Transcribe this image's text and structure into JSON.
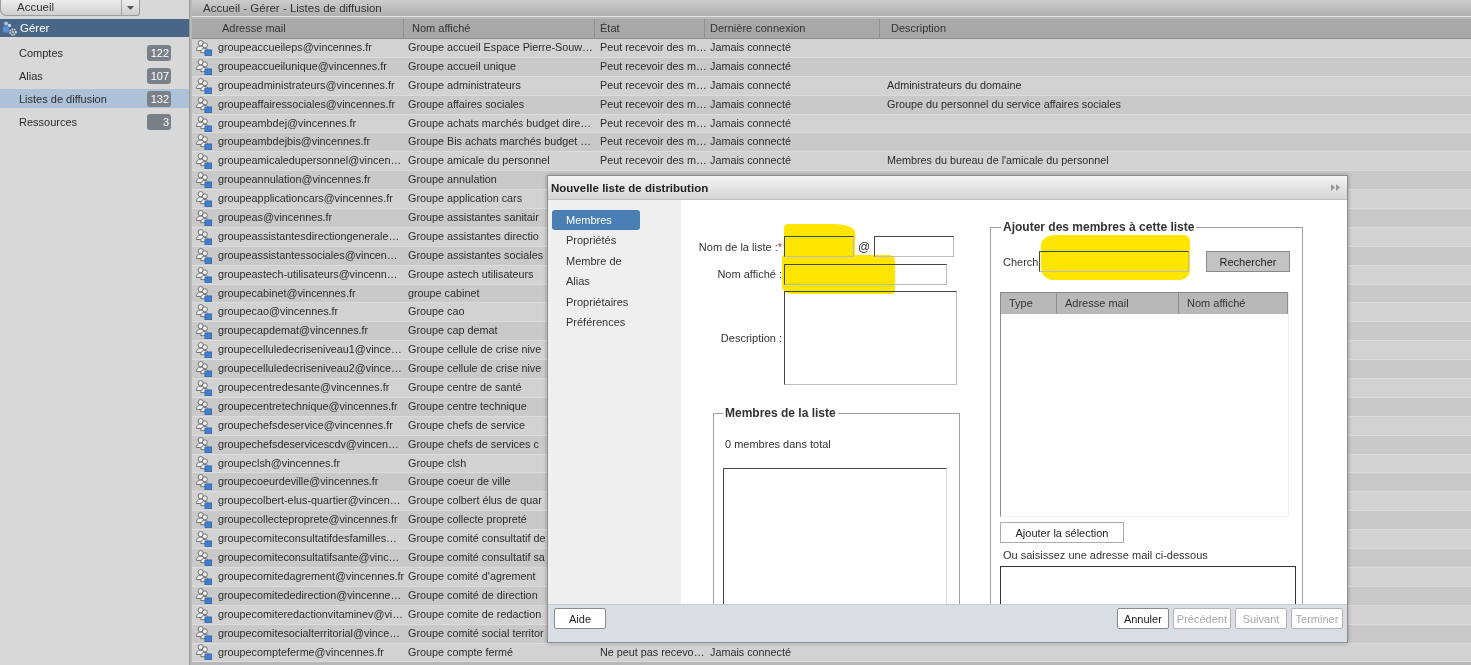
{
  "sidebar": {
    "dropdown": "Accueil",
    "section": "Gérer",
    "items": [
      {
        "label": "Comptes",
        "count": "122",
        "selected": false
      },
      {
        "label": "Alias",
        "count": "107",
        "selected": false
      },
      {
        "label": "Listes de diffusion",
        "count": "132",
        "selected": true
      },
      {
        "label": "Ressources",
        "count": "3",
        "selected": false
      }
    ]
  },
  "breadcrumb": "Accueil - Gérer - Listes de diffusion",
  "table": {
    "columns": [
      "Adresse mail",
      "Nom affiché",
      "État",
      "Dernière connexion",
      "Description"
    ],
    "rows": [
      {
        "address": "groupeaccueileps@vincennes.fr",
        "display_name": "Groupe accueil Espace Pierre-Souw…",
        "state": "Peut recevoir des m…",
        "last_login": "Jamais connecté"
      },
      {
        "address": "groupeaccueilunique@vincennes.fr",
        "display_name": "Groupe accueil unique",
        "state": "Peut recevoir des m…",
        "last_login": "Jamais connecté"
      },
      {
        "address": "groupeadministrateurs@vincennes.fr",
        "display_name": "Groupe administrateurs",
        "state": "Peut recevoir des m…",
        "last_login": "Jamais connecté",
        "description": "Administrateurs du domaine"
      },
      {
        "address": "groupeaffairessociales@vincennes.fr",
        "display_name": "Groupe affaires sociales",
        "state": "Peut recevoir des m…",
        "last_login": "Jamais connecté",
        "description": "Groupe du personnel du service affaires sociales"
      },
      {
        "address": "groupeambdej@vincennes.fr",
        "display_name": "Groupe achats marchés budget dire…",
        "state": "Peut recevoir des m…",
        "last_login": "Jamais connecté"
      },
      {
        "address": "groupeambdejbis@vincennes.fr",
        "display_name": "Groupe Bis achats marchés budget …",
        "state": "Peut recevoir des m…",
        "last_login": "Jamais connecté"
      },
      {
        "address": "groupeamicaledupersonnel@vincen…",
        "display_name": "Groupe amicale du personnel",
        "state": "Peut recevoir des m…",
        "last_login": "Jamais connecté",
        "description": "Membres du bureau de l'amicale du personnel"
      },
      {
        "address": "groupeannulation@vincennes.fr",
        "display_name": "Groupe annulation"
      },
      {
        "address": "groupeapplicationcars@vincennes.fr",
        "display_name": "Groupe application cars"
      },
      {
        "address": "groupeas@vincennes.fr",
        "display_name": "Groupe assistantes sanitair"
      },
      {
        "address": "groupeassistantesdirectiongenerale…",
        "display_name": "Groupe assistantes directio"
      },
      {
        "address": "groupeassistantessociales@vincen…",
        "display_name": "Groupe assistantes sociales"
      },
      {
        "address": "groupeastech-utilisateurs@vincenn…",
        "display_name": "Groupe astech utilisateurs"
      },
      {
        "address": "groupecabinet@vincennes.fr",
        "display_name": "groupe cabinet"
      },
      {
        "address": "groupecao@vincennes.fr",
        "display_name": "Groupe cao"
      },
      {
        "address": "groupecapdemat@vincennes.fr",
        "display_name": "Groupe cap demat"
      },
      {
        "address": "groupecelluledecriseniveau1@vince…",
        "display_name": "Groupe cellule de crise nive"
      },
      {
        "address": "groupecelluledecriseniveau2@vince…",
        "display_name": "Groupe cellule de crise nive"
      },
      {
        "address": "groupecentredesante@vincennes.fr",
        "display_name": "Groupe centre de santé"
      },
      {
        "address": "groupecentretechnique@vincennes.fr",
        "display_name": "Groupe centre technique"
      },
      {
        "address": "groupechefsdeservice@vincennes.fr",
        "display_name": "Groupe chefs de service"
      },
      {
        "address": "groupechefsdeservicescdv@vincen…",
        "display_name": "Groupe chefs de services c"
      },
      {
        "address": "groupeclsh@vincennes.fr",
        "display_name": "Groupe clsh"
      },
      {
        "address": "groupecoeurdeville@vincennes.fr",
        "display_name": "Groupe coeur de ville"
      },
      {
        "address": "groupecolbert-elus-quartier@vincen…",
        "display_name": "Groupe colbert élus de quar"
      },
      {
        "address": "groupecollecteproprete@vincennes.fr",
        "display_name": "Groupe collecte propreté"
      },
      {
        "address": "groupecomiteconsultatifdesfamilles…",
        "display_name": "Groupe comité consultatif de"
      },
      {
        "address": "groupecomiteconsultatifsante@vinc…",
        "display_name": "Groupe comité consultatif sa"
      },
      {
        "address": "groupecomitedagrement@vincennes.fr",
        "display_name": "Groupe comité d'agrement"
      },
      {
        "address": "groupecomitededirection@vincenne…",
        "display_name": "Groupe comité de direction"
      },
      {
        "address": "groupecomiteredactionvitaminev@vi…",
        "display_name": "Groupe comite de redaction"
      },
      {
        "address": "groupecomitesocialterritorial@vince…",
        "display_name": "Groupe comité social territor"
      },
      {
        "address": "groupecompteferme@vincennes.fr",
        "display_name": "Groupe compte fermé",
        "state": "Ne peut pas recevo…",
        "last_login": "Jamais connecté"
      }
    ]
  },
  "dialog": {
    "title": "Nouvelle liste de distribution",
    "nav": [
      {
        "label": "Membres",
        "selected": true
      },
      {
        "label": "Propriétés",
        "selected": false
      },
      {
        "label": "Membre de",
        "selected": false
      },
      {
        "label": "Alias",
        "selected": false
      },
      {
        "label": "Propriétaires",
        "selected": false
      },
      {
        "label": "Préférences",
        "selected": false
      }
    ],
    "form": {
      "fields": [
        {
          "kind": "name_at_domain",
          "label": "Nom de la liste :",
          "required_mark": "*",
          "separator": "@",
          "highlighted": true
        },
        {
          "kind": "text",
          "label": "Nom affiché :",
          "highlighted": true
        },
        {
          "kind": "textarea",
          "label": "Description :",
          "highlighted": false
        }
      ]
    },
    "members": {
      "legend": "Membres de la liste",
      "count_text": "0 membres dans total"
    },
    "add_members": {
      "legend": "Ajouter des membres à cette liste",
      "search": {
        "label": "Cherch",
        "highlighted": true
      },
      "search_button": "Rechercher",
      "result_columns": [
        "Type",
        "Adresse mail",
        "Nom affiché"
      ],
      "add_button": "Ajouter la sélection",
      "manual_hint": "Ou saisissez une adresse mail ci-dessous"
    },
    "footer": {
      "left_buttons": [
        {
          "label": "Aide",
          "disabled": false
        }
      ],
      "right_buttons": [
        {
          "label": "Annuler",
          "disabled": false
        },
        {
          "label": "Précédent",
          "disabled": true
        },
        {
          "label": "Suivant",
          "disabled": true
        },
        {
          "label": "Terminer",
          "disabled": true
        }
      ]
    }
  }
}
